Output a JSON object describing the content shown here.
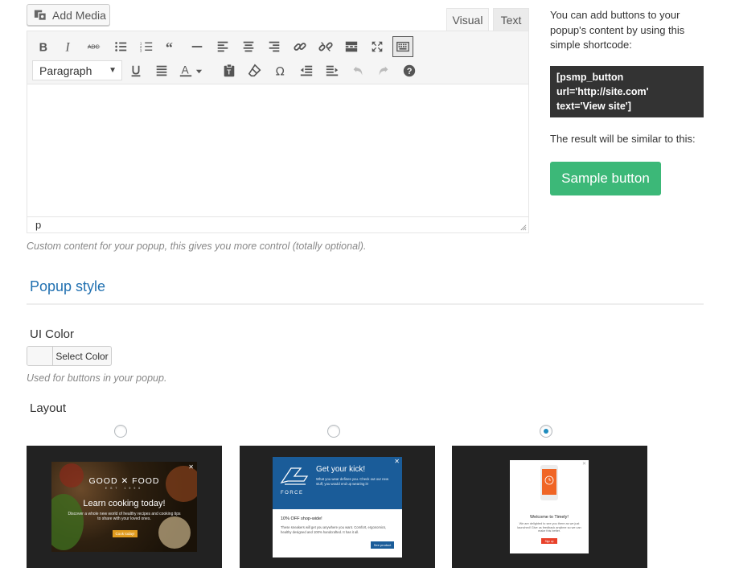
{
  "editor": {
    "add_media_label": "Add Media",
    "tabs": [
      {
        "label": "Visual"
      },
      {
        "label": "Text"
      }
    ],
    "format_select_value": "Paragraph",
    "status_path": "p",
    "help_text": "Custom content for your popup, this gives you more control (totally optional)."
  },
  "sidebar": {
    "intro_line1": "You can add buttons to your",
    "intro_line2": "popup's content by using this",
    "intro_line3": "simple shortcode:",
    "code_line1": "[psmp_button",
    "code_line2": "url='http://site.com'",
    "code_line3": "text='View site']",
    "result_text": "The result will be similar to this:",
    "sample_button_label": "Sample button",
    "sample_button_color": "#3cb878"
  },
  "popup_style": {
    "section_title": "Popup style",
    "ui_color_label": "UI Color",
    "select_color_label": "Select Color",
    "ui_color_help": "Used for buttons in your popup.",
    "layout_label": "Layout",
    "accent_color": "#2271b1",
    "layouts": [
      {
        "selected": false,
        "preview": {
          "logo": "GOOD ✕ FOOD",
          "logo_sub": "EST 1996",
          "title": "Learn cooking today!",
          "description": "Discover a whole new world of healthy recipes and cooking tips to share with your loved ones.",
          "button": "Cook today!",
          "close": "✕"
        }
      },
      {
        "selected": false,
        "preview": {
          "title": "Get your kick!",
          "description": "What you wear defines you. Check out our new stuff, you would end up wearing it!",
          "brand": "FORCE",
          "offer": "10% OFF shop-wide!",
          "body": "These sneakers will get you anywhere you want. Comfort, ergonomics, healthy designed and 100% handcrafted. It has it all.",
          "button": "See product",
          "close": "✕"
        }
      },
      {
        "selected": true,
        "preview": {
          "title": "Welcome to Timely!",
          "description": "We are delighted to see you there as we just launched! Give us feedback anytime so we can make this better.",
          "button": "Sign up",
          "close": "✕"
        }
      }
    ]
  }
}
